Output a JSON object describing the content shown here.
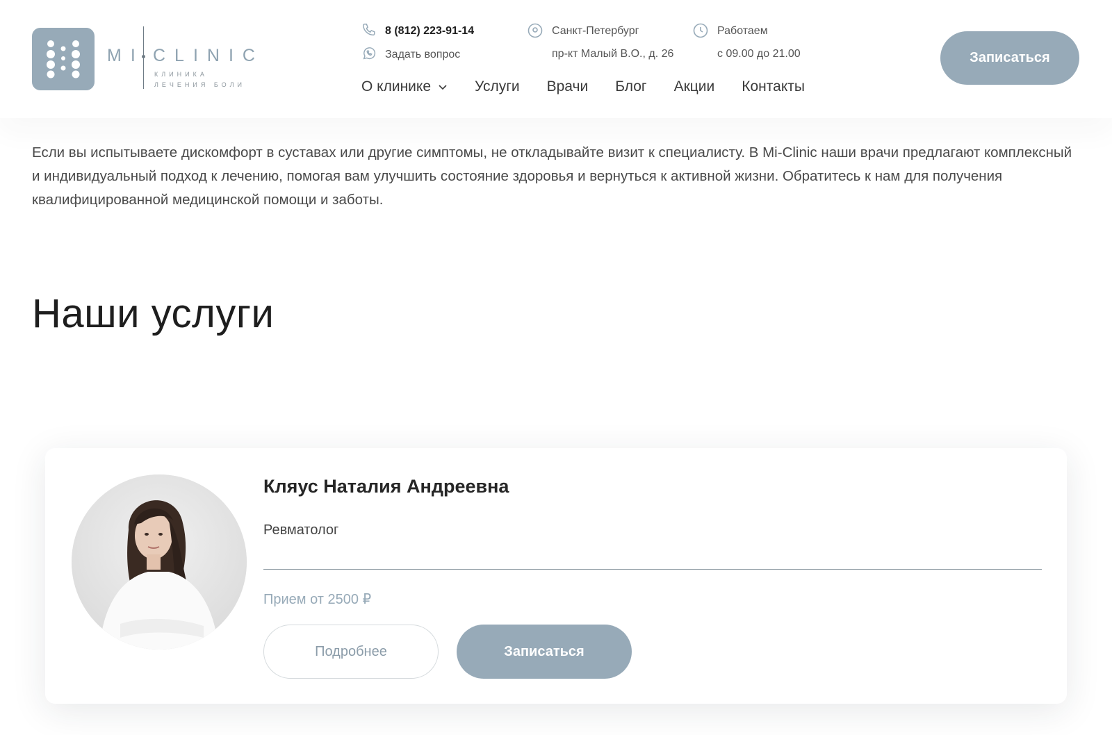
{
  "header": {
    "logo": {
      "word_left": "MI",
      "word_right": "CLINIC",
      "subtitle_line1": "КЛИНИКА",
      "subtitle_line2": "ЛЕЧЕНИЯ БОЛИ"
    },
    "phone": "8 (812) 223-91-14",
    "ask_question": "Задать вопрос",
    "city": "Санкт-Петербург",
    "address": "пр-кт Малый В.О., д. 26",
    "hours_label": "Работаем",
    "hours_value": "с 09.00 до 21.00",
    "cta_label": "Записаться",
    "nav": [
      {
        "label": "О клинике"
      },
      {
        "label": "Услуги"
      },
      {
        "label": "Врачи"
      },
      {
        "label": "Блог"
      },
      {
        "label": "Акции"
      },
      {
        "label": "Контакты"
      }
    ]
  },
  "intro": {
    "text": "Если вы испытываете дискомфорт в суставах или другие симптомы, не откладывайте визит к специалисту. В Mi-Clinic наши врачи предлагают комплексный и индивидуальный подход к лечению, помогая вам улучшить состояние здоровья и вернуться к активной жизни. Обратитесь к нам для получения квалифицированной медицинской помощи и заботы."
  },
  "section": {
    "title": "Наши услуги"
  },
  "doctor_card": {
    "name": "Кляус Наталия Андреевна",
    "specialty": "Ревматолог",
    "price": "Прием от 2500 ₽",
    "details_label": "Подробнее",
    "cta_label": "Записаться"
  },
  "colors": {
    "accent": "#97aab8",
    "text": "#2b2b2b",
    "divider": "#8d99a2"
  },
  "icons": [
    "phone-icon",
    "whatsapp-icon",
    "location-pin-icon",
    "clock-icon",
    "chevron-down-icon"
  ]
}
